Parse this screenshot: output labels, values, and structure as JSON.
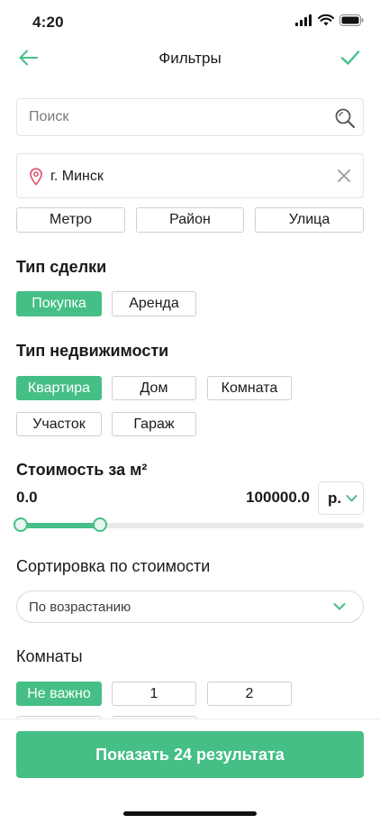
{
  "status_bar": {
    "time": "4:20"
  },
  "header": {
    "title": "Фильтры"
  },
  "search": {
    "placeholder": "Поиск",
    "value": ""
  },
  "location": {
    "value": "г. Минск"
  },
  "location_filters": [
    "Метро",
    "Район",
    "Улица"
  ],
  "deal_type": {
    "title": "Тип сделки",
    "options": [
      "Покупка",
      "Аренда"
    ],
    "selected": "Покупка"
  },
  "property_type": {
    "title": "Тип недвижимости",
    "options": [
      "Квартира",
      "Дом",
      "Комната",
      "Участок",
      "Гараж"
    ],
    "selected": "Квартира"
  },
  "price": {
    "title": "Стоимость за м²",
    "min_label": "0.0",
    "max_label": "100000.0",
    "currency": "р.",
    "range_fraction": [
      0.0,
      0.23
    ]
  },
  "sort": {
    "title": "Сортировка по стоимости",
    "selected": "По возрастанию"
  },
  "rooms": {
    "title": "Комнаты",
    "options": [
      "Не важно",
      "1",
      "2"
    ],
    "selected": "Не важно"
  },
  "footer": {
    "show_button": "Показать 24 результата"
  },
  "colors": {
    "accent": "#45bf86",
    "pin": "#e0506f"
  }
}
